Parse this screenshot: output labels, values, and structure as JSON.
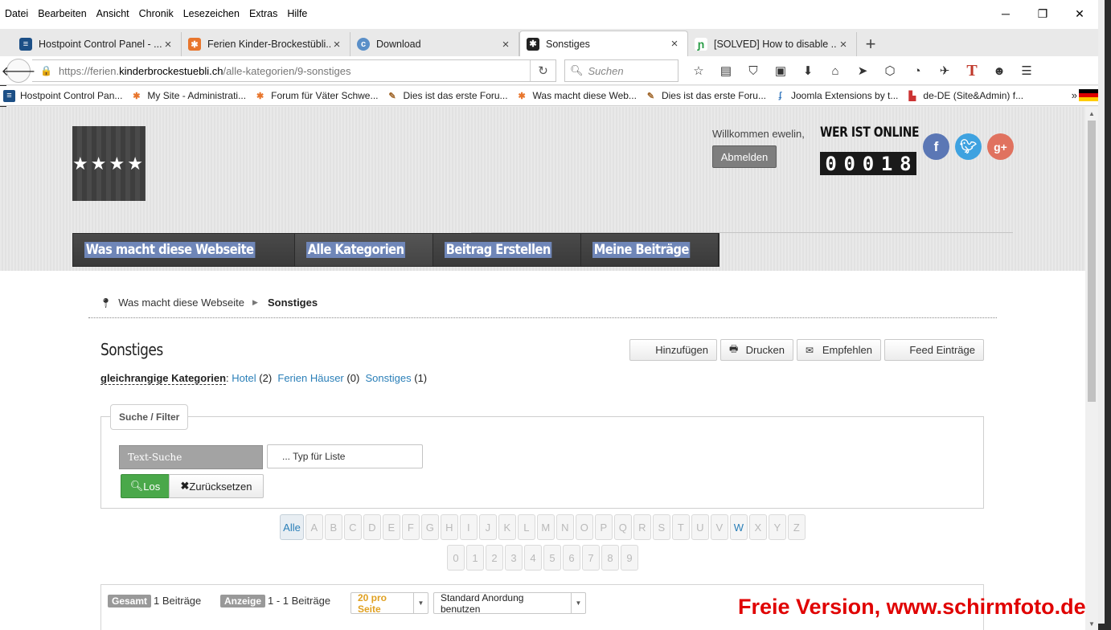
{
  "menubar": {
    "items": [
      "Datei",
      "Bearbeiten",
      "Ansicht",
      "Chronik",
      "Lesezeichen",
      "Extras",
      "Hilfe"
    ],
    "window_controls": [
      "─",
      "❐",
      "✕"
    ]
  },
  "tabs": [
    {
      "label": "Hostpoint Control Panel - ...",
      "icon": "hostpoint-icon",
      "active": false
    },
    {
      "label": "Ferien Kinder-Brockestübli...",
      "icon": "joomla-icon",
      "active": false
    },
    {
      "label": "Download",
      "icon": "download-site-icon",
      "active": false
    },
    {
      "label": "Sonstiges",
      "icon": "joomla-icon",
      "active": true
    },
    {
      "label": "[SOLVED] How to disable ...",
      "icon": "forum-icon",
      "active": false
    }
  ],
  "navbar": {
    "url_prefix": "https://ferien.",
    "url_host": "kinderbrockestuebli.ch",
    "url_path": "/alle-kategorien/9-sonstiges",
    "search_placeholder": "Suchen"
  },
  "bookmarks": [
    {
      "label": "Hostpoint Control Pan...",
      "icon": "hostpoint-icon"
    },
    {
      "label": "My Site - Administrati...",
      "icon": "joomla-icon"
    },
    {
      "label": "Forum für Väter Schwe...",
      "icon": "joomla-icon"
    },
    {
      "label": "Dies ist das erste Foru...",
      "icon": "forum-icon"
    },
    {
      "label": "Was macht diese Web...",
      "icon": "joomla-icon"
    },
    {
      "label": "Dies ist das erste Foru...",
      "icon": "forum-icon"
    },
    {
      "label": "Joomla Extensions by t...",
      "icon": "extensions-icon"
    },
    {
      "label": "de-DE (Site&Admin) f...",
      "icon": "language-icon"
    }
  ],
  "header": {
    "logo_stars": "★★★★",
    "welcome": "Willkommen ewelin,",
    "logout_label": "Abmelden",
    "online_title": "WER IST ONLINE",
    "counter_digits": [
      "0",
      "0",
      "0",
      "1",
      "8"
    ]
  },
  "mainnav": [
    {
      "label": "Was macht diese Webseite"
    },
    {
      "label": "Alle Kategorien",
      "current": true
    },
    {
      "label": "Beitrag Erstellen"
    },
    {
      "label": "Meine Beiträge"
    }
  ],
  "breadcrumb": {
    "home": "Was macht diese Webseite",
    "current": "Sonstiges"
  },
  "category": {
    "title": "Sonstiges",
    "actions": {
      "add": "Hinzufügen",
      "print": "Drucken",
      "recommend": "Empfehlen",
      "feed": "Feed Einträge"
    },
    "siblings_label": "gleichrangige Kategorien",
    "siblings": [
      {
        "name": "Hotel",
        "count": "(2)"
      },
      {
        "name": "Ferien Häuser",
        "count": "(0)"
      },
      {
        "name": "Sonstiges",
        "count": "(1)"
      }
    ]
  },
  "filter": {
    "legend": "Suche / Filter",
    "search_label": "Text-Suche",
    "search_placeholder": "... Typ für Liste",
    "go_label": "Los",
    "reset_label": "Zurücksetzen"
  },
  "alphabet": {
    "letters": [
      "Alle",
      "A",
      "B",
      "C",
      "D",
      "E",
      "F",
      "G",
      "H",
      "I",
      "J",
      "K",
      "L",
      "M",
      "N",
      "O",
      "P",
      "Q",
      "R",
      "S",
      "T",
      "U",
      "V",
      "W",
      "X",
      "Y",
      "Z"
    ],
    "digits": [
      "0",
      "1",
      "2",
      "3",
      "4",
      "5",
      "6",
      "7",
      "8",
      "9"
    ],
    "active": "Alle",
    "linked": [
      "W"
    ]
  },
  "stats": {
    "total_tag": "Gesamt",
    "total_value": "1 Beiträge",
    "shown_tag": "Anzeige",
    "shown_value": "1 - 1 Beiträge",
    "per_page": "20 pro Seite",
    "order": "Standard Anordung benutzen"
  },
  "watermark": "Freie Version, www.schirmfoto.de",
  "colors": {
    "link": "#2a7fb8",
    "go_button": "#4aa84a",
    "watermark": "#e00000",
    "nav_highlight": "#6f86b8"
  }
}
